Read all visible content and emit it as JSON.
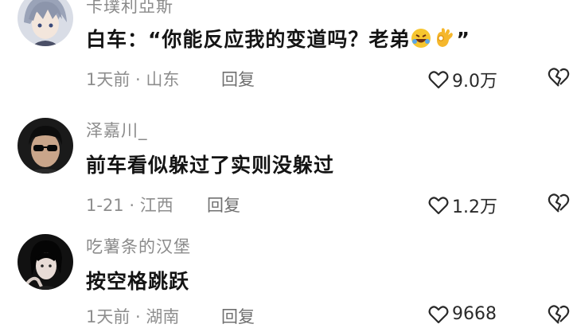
{
  "comments": [
    {
      "username": "卡璞利亞斯",
      "text_before": "白车：“你能反应我的变道吗？老弟",
      "emojis": [
        "rolling-on-floor-laughing",
        "ok-hand"
      ],
      "text_after": "”",
      "time": "1天前",
      "location": "山东",
      "reply_label": "回复",
      "likes": "9.0万"
    },
    {
      "username": "泽嘉川_",
      "text": "前车看似躲过了实则没躲过",
      "time": "1-21",
      "location": "江西",
      "reply_label": "回复",
      "likes": "1.2万"
    },
    {
      "username": "吃薯条的汉堡",
      "text": "按空格跳跃",
      "time": "1天前",
      "location": "湖南",
      "reply_label": "回复",
      "likes": "9668"
    }
  ],
  "colors": {
    "background": "#ffffff",
    "text": "#141414",
    "muted": "#8e8e8e"
  },
  "icons": [
    "heart-icon",
    "broken-heart-icon"
  ]
}
